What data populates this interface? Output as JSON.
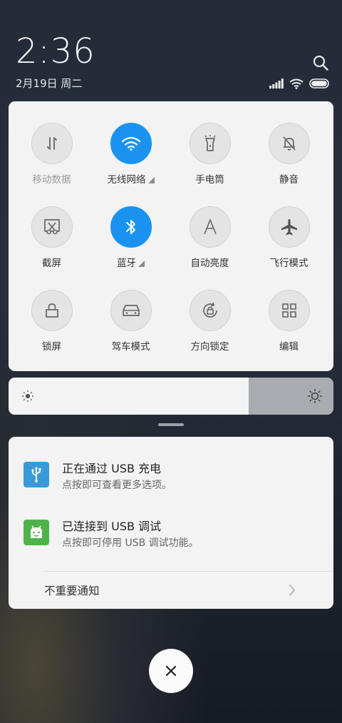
{
  "header": {
    "time": "2:36",
    "date": "2月19日 周二"
  },
  "quick_settings": [
    {
      "label": "移动数据",
      "icon": "mobile-data-icon",
      "active": false,
      "dim": true,
      "expand": false
    },
    {
      "label": "无线网络",
      "icon": "wifi-icon",
      "active": true,
      "dim": false,
      "expand": true
    },
    {
      "label": "手电筒",
      "icon": "flashlight-icon",
      "active": false,
      "dim": false,
      "expand": false
    },
    {
      "label": "静音",
      "icon": "mute-bell-icon",
      "active": false,
      "dim": false,
      "expand": false
    },
    {
      "label": "截屏",
      "icon": "screenshot-icon",
      "active": false,
      "dim": false,
      "expand": false
    },
    {
      "label": "蓝牙",
      "icon": "bluetooth-icon",
      "active": true,
      "dim": false,
      "expand": true
    },
    {
      "label": "自动亮度",
      "icon": "auto-brightness-icon",
      "active": false,
      "dim": false,
      "expand": false
    },
    {
      "label": "飞行模式",
      "icon": "airplane-icon",
      "active": false,
      "dim": false,
      "expand": false
    },
    {
      "label": "锁屏",
      "icon": "lock-icon",
      "active": false,
      "dim": false,
      "expand": false
    },
    {
      "label": "驾车模式",
      "icon": "car-icon",
      "active": false,
      "dim": false,
      "expand": false
    },
    {
      "label": "方向锁定",
      "icon": "rotation-lock-icon",
      "active": false,
      "dim": false,
      "expand": false
    },
    {
      "label": "编辑",
      "icon": "edit-grid-icon",
      "active": false,
      "dim": false,
      "expand": false
    }
  ],
  "brightness": {
    "level": 0.74
  },
  "notifications": [
    {
      "title": "正在通过 USB 充电",
      "subtitle": "点按即可查看更多选项。",
      "icon": "usb-icon",
      "color": "#3a9ad9"
    },
    {
      "title": "已连接到 USB 调试",
      "subtitle": "点按即可停用 USB 调试功能。",
      "icon": "android-debug-icon",
      "color": "#4fb34c"
    }
  ],
  "unimportant": {
    "label": "不重要通知"
  },
  "colors": {
    "accent": "#1a93f0",
    "panel": "#f3f3f3"
  }
}
